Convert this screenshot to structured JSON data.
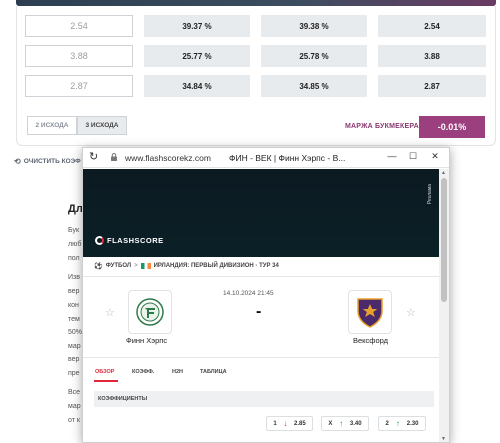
{
  "calculator": {
    "rows": [
      {
        "input": "2.54",
        "p1": "39.37 %",
        "p2": "39.38 %",
        "result": "2.54"
      },
      {
        "input": "3.88",
        "p1": "25.77 %",
        "p2": "25.78 %",
        "result": "3.88"
      },
      {
        "input": "2.87",
        "p1": "34.84 %",
        "p2": "34.85 %",
        "result": "2.87"
      }
    ],
    "tabs": [
      "2 ИСХОДА",
      "3 ИСХОДА"
    ],
    "active_tab": "3 ИСХОДА",
    "margin_label": "МАРЖА БУКМЕКЕРА",
    "margin_value": "-0.01%",
    "clear_label": "ОЧИСТИТЬ КОЭФ"
  },
  "article": {
    "heading": "Дл",
    "lines": [
      "Бук",
      "люб",
      "пол",
      "Изв",
      "вер",
      "кон",
      "тем",
      "50%",
      "мар",
      "вер",
      "пре",
      "Все",
      "мар",
      "от к"
    ]
  },
  "popup": {
    "url": "www.flashscorekz.com",
    "title": "ФИН - ВЕК | Финн Хэрпс - В...",
    "window_buttons": {
      "minimize": "—",
      "maximize": "☐",
      "close": "✕"
    },
    "ad_label": "Реклама",
    "logo": "FLASHSCORE",
    "breadcrumb": {
      "sport": "ФУТБОЛ",
      "separator": ">",
      "league": "ИРЛАНДИЯ: ПЕРВЫЙ ДИВИЗИОН · ТУР 34"
    },
    "match": {
      "date": "14.10.2024 21:45",
      "score": "-",
      "home": "Финн Хэрпс",
      "away": "Вексфорд"
    },
    "tabs": [
      "ОБЗОР",
      "КОЭФФ.",
      "H2H",
      "ТАБЛИЦА"
    ],
    "odds_header": "КОЭФФИЦИЕНТЫ",
    "odds": [
      {
        "label": "1",
        "value": "2.85",
        "trend": "down"
      },
      {
        "label": "X",
        "value": "3.40",
        "trend": "up"
      },
      {
        "label": "2",
        "value": "2.30",
        "trend": "up"
      }
    ]
  },
  "colors": {
    "accent": "#9c3f7e",
    "flashscore_red": "#e0283a",
    "flashscore_dark": "#0c1a22"
  }
}
